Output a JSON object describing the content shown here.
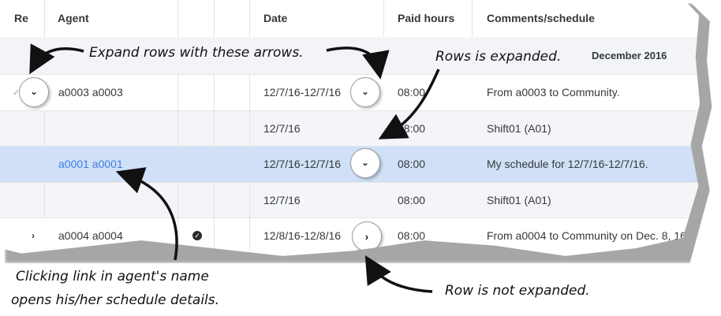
{
  "columns": {
    "re": "Re",
    "agent": "Agent",
    "date": "Date",
    "paid_hours": "Paid hours",
    "comments": "Comments/schedule"
  },
  "group_row": {
    "label": "December 2016"
  },
  "rows": [
    {
      "agent": "a0003 a0003",
      "date": "12/7/16-12/7/16",
      "paid_hours": "08:00",
      "comments": "From a0003 to Community.",
      "expand_icon": "chevron-down-icon"
    },
    {
      "agent": "",
      "date": "12/7/16",
      "paid_hours": "08:00",
      "comments": "Shift01 (A01)"
    },
    {
      "agent": "a0001 a0001",
      "date": "12/7/16-12/7/16",
      "paid_hours": "08:00",
      "comments": "My schedule for 12/7/16-12/7/16.",
      "expand_icon": "chevron-down-icon",
      "selected": true
    },
    {
      "agent": "",
      "date": "12/7/16",
      "paid_hours": "08:00",
      "comments": "Shift01 (A01)"
    },
    {
      "agent": "a0004 a0004",
      "date": "12/8/16-12/8/16",
      "paid_hours": "08:00",
      "comments": "From a0004 to Community on Dec. 8, 16.",
      "expand_icon": "chevron-right-icon",
      "status_icon": "check-circle-icon"
    }
  ],
  "annotations": {
    "expand_rows": "Expand rows with these arrows.",
    "rows_expanded": "Rows is expanded.",
    "clicking_link_line1": "Clicking link in agent's name",
    "clicking_link_line2": "opens his/her schedule details.",
    "row_not_expanded": "Row is not expanded."
  },
  "colors": {
    "selected_row": "#cfe0f7",
    "group_row": "#f2f4f8",
    "sub_row": "#f4f5f8",
    "link": "#3f7ee0"
  }
}
